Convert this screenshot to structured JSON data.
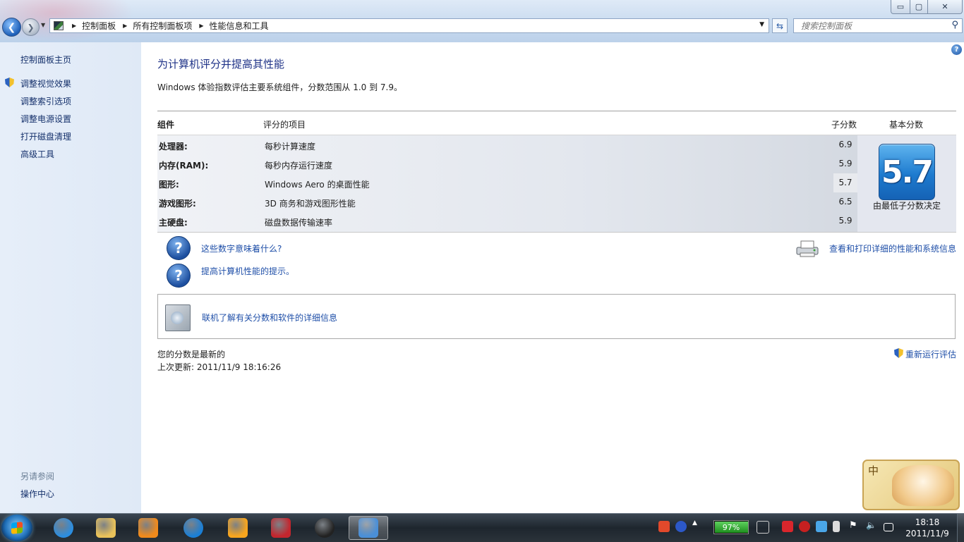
{
  "window": {
    "min_glyph": "▭",
    "max_glyph": "▢",
    "close_glyph": "✕"
  },
  "address": {
    "crumbs": [
      "控制面板",
      "所有控制面板项",
      "性能信息和工具"
    ]
  },
  "search": {
    "placeholder": "搜索控制面板"
  },
  "sidebar": {
    "home": "控制面板主页",
    "items": [
      {
        "label": "调整视觉效果"
      },
      {
        "label": "调整索引选项"
      },
      {
        "label": "调整电源设置"
      },
      {
        "label": "打开磁盘清理"
      },
      {
        "label": "高级工具"
      }
    ],
    "see_also_title": "另请参阅",
    "see_also_items": [
      "操作中心"
    ]
  },
  "main": {
    "title": "为计算机评分并提高其性能",
    "subtitle": "Windows 体验指数评估主要系统组件，分数范围从 1.0 到 7.9。",
    "table": {
      "headers": {
        "component": "组件",
        "rated_item": "评分的项目",
        "subscore": "子分数",
        "base_score": "基本分数"
      },
      "rows": [
        {
          "component": "处理器:",
          "item": "每秒计算速度",
          "subscore": "6.9"
        },
        {
          "component": "内存(RAM):",
          "item": "每秒内存运行速度",
          "subscore": "5.9"
        },
        {
          "component": "图形:",
          "item": "Windows Aero 的桌面性能",
          "subscore": "5.7"
        },
        {
          "component": "游戏图形:",
          "item": "3D 商务和游戏图形性能",
          "subscore": "6.5"
        },
        {
          "component": "主硬盘:",
          "item": "磁盘数据传输速率",
          "subscore": "5.9"
        }
      ],
      "base_score": "5.7",
      "base_note": "由最低子分数决定"
    },
    "links": {
      "what_numbers_mean": "这些数字意味着什么?",
      "tips": "提高计算机性能的提示。",
      "print_details": "查看和打印详细的性能和系统信息",
      "online_info": "联机了解有关分数和软件的详细信息",
      "rerun": "重新运行评估"
    },
    "status": "您的分数是最新的",
    "last_updated": "上次更新: 2011/11/9 18:16:26"
  },
  "ime": {
    "label": "中"
  },
  "taskbar": {
    "battery_percent": "97%",
    "battery_level": 0.97,
    "time": "18:18",
    "date": "2011/11/9",
    "apps": [
      {
        "name": "internet-explorer",
        "color": "#2b8de0"
      },
      {
        "name": "windows-explorer",
        "color": "#e9c25a"
      },
      {
        "name": "media-player",
        "color": "#f08a1c"
      },
      {
        "name": "sogou-browser",
        "color": "#1a7fd6"
      },
      {
        "name": "pps-player",
        "color": "#f7a51e"
      },
      {
        "name": "autocad",
        "color": "#c3262e"
      },
      {
        "name": "qq",
        "color": "#222222"
      },
      {
        "name": "control-panel",
        "color": "#4a8fd8"
      }
    ]
  },
  "colors": {
    "link": "#1f4fa8",
    "title": "#1e3287",
    "sidebar_link": "#14306b"
  }
}
